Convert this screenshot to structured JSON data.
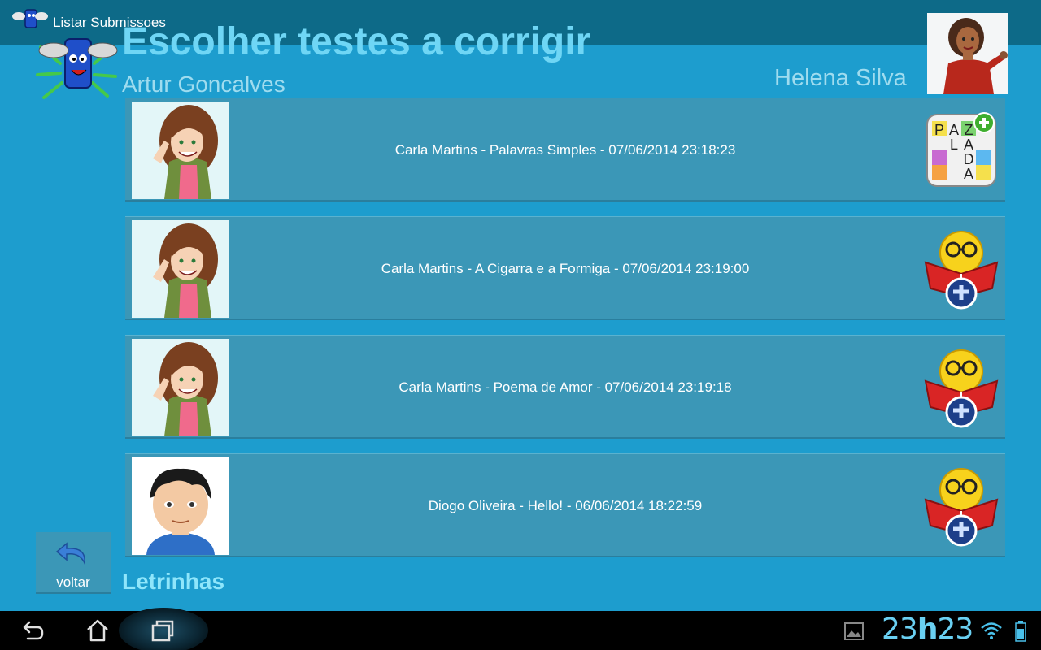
{
  "window": {
    "title": "Listar Submissoes"
  },
  "header": {
    "title": "Escolher testes a corrigir",
    "student": "Artur Goncalves",
    "teacher": "Helena Silva"
  },
  "submissions": [
    {
      "label": "Carla Martins - Palavras Simples - 07/06/2014 23:18:23",
      "avatar": "girl-avatar",
      "icon": "word-puzzle-icon"
    },
    {
      "label": "Carla Martins - A Cigarra e a Formiga - 07/06/2014 23:19:00",
      "avatar": "girl-avatar",
      "icon": "reading-puzzle-icon"
    },
    {
      "label": "Carla Martins - Poema de Amor - 07/06/2014 23:19:18",
      "avatar": "girl-avatar",
      "icon": "reading-puzzle-icon"
    },
    {
      "label": "Diogo Oliveira - Hello! - 06/06/2014 18:22:59",
      "avatar": "boy-avatar",
      "icon": "reading-puzzle-icon"
    }
  ],
  "back_button": {
    "label": "voltar"
  },
  "footer": {
    "brand": "Letrinhas"
  },
  "status_bar": {
    "clock_hours": "23",
    "clock_sep": "h",
    "clock_minutes": "23"
  },
  "colors": {
    "background": "#1d9dce",
    "titlebar": "#0d6a88",
    "row": "#3b97b7",
    "title_text": "#6fd6f5"
  }
}
